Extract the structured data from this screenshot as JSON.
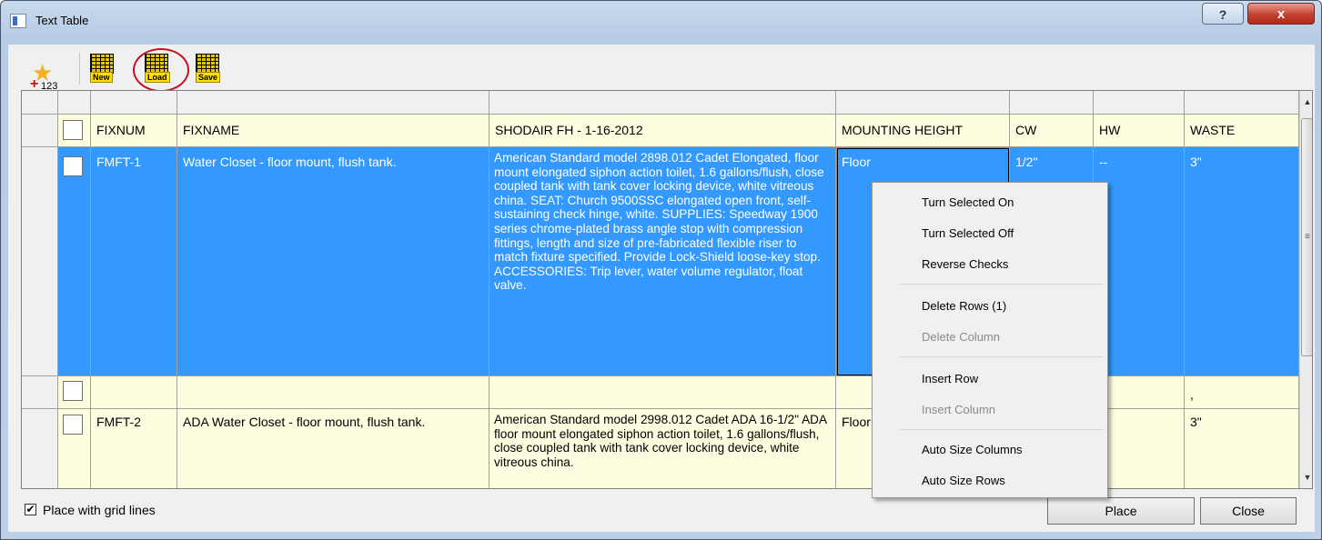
{
  "window": {
    "title": "Text Table",
    "help_glyph": "?",
    "close_glyph": "x"
  },
  "toolbar": {
    "numbering_label": "123",
    "new_label": "New",
    "load_label": "Load",
    "save_label": "Save"
  },
  "table": {
    "columns": [
      "FIXNUM",
      "FIXNAME",
      "SHODAIR FH - 1-16-2012",
      "MOUNTING HEIGHT",
      "CW",
      "HW",
      "WASTE"
    ],
    "rows": [
      {
        "fixnum": "FMFT-1",
        "fixname": "Water Closet - floor mount, flush tank.",
        "description": "American Standard model 2898.012 Cadet Elongated, floor mount elongated siphon action toilet, 1.6 gallons/flush, close coupled tank with tank cover locking device, white vitreous china. SEAT:  Church 9500SSC elongated open front, self-sustaining check hinge, white.  SUPPLIES: Speedway 1900 series chrome-plated brass angle stop with compression fittings, length and size of pre-fabricated flexible riser to match fixture specified.  Provide Lock-Shield loose-key stop. ACCESSORIES:  Trip lever, water volume regulator, float valve.",
        "mounting_height": "Floor",
        "cw": "1/2\"",
        "hw": "--",
        "waste": "3\""
      },
      {
        "fixnum": "",
        "fixname": "",
        "description": "",
        "mounting_height": "",
        "cw": "",
        "hw": "",
        "waste": ","
      },
      {
        "fixnum": "FMFT-2",
        "fixname": "ADA Water Closet - floor mount, flush tank.",
        "description": "American Standard model 2998.012 Cadet ADA 16-1/2\"  ADA floor mount elongated siphon action toilet, 1.6 gallons/flush, close coupled tank with tank cover locking device, white vitreous china.",
        "mounting_height": "Floor",
        "cw": "",
        "hw": "--",
        "waste": "3\""
      }
    ]
  },
  "context_menu": {
    "items": [
      {
        "label": "Turn Selected On",
        "enabled": true
      },
      {
        "label": "Turn Selected Off",
        "enabled": true
      },
      {
        "label": "Reverse Checks",
        "enabled": true
      },
      {
        "label": "Delete Rows (1)",
        "enabled": true
      },
      {
        "label": "Delete Column",
        "enabled": false
      },
      {
        "label": "Insert Row",
        "enabled": true
      },
      {
        "label": "Insert Column",
        "enabled": false
      },
      {
        "label": "Auto Size Columns",
        "enabled": true
      },
      {
        "label": "Auto Size Rows",
        "enabled": true
      }
    ]
  },
  "footer": {
    "grid_lines_label": "Place with grid lines",
    "grid_lines_checked": true,
    "check_glyph": "✔",
    "place_label": "Place",
    "close_label": "Close"
  },
  "colors": {
    "selection": "#3399ff",
    "row_background": "#fffde0",
    "highlight_circle": "#c2121f"
  }
}
